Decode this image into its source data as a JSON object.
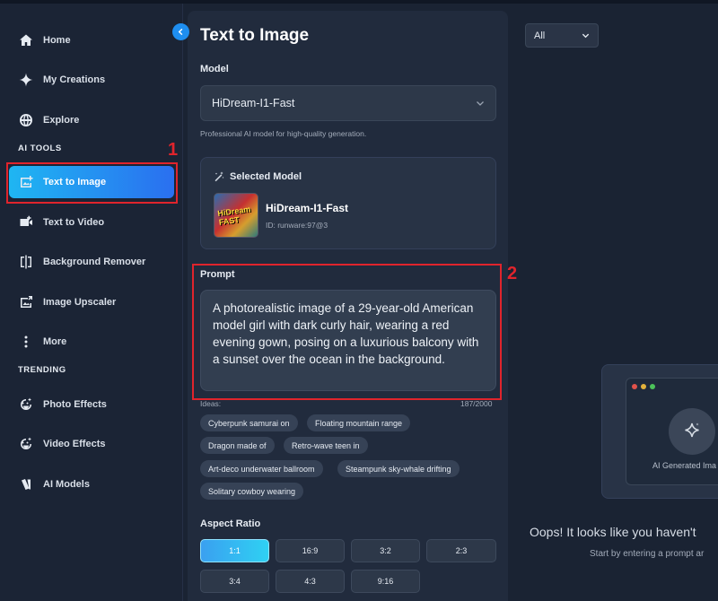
{
  "sidebar": {
    "items": [
      {
        "label": "Home",
        "icon": "home-icon"
      },
      {
        "label": "My Creations",
        "icon": "sparkle-icon"
      },
      {
        "label": "Explore",
        "icon": "globe-icon"
      },
      {
        "label": "Text to Image",
        "icon": "image-plus-icon",
        "active": true
      },
      {
        "label": "Text to Video",
        "icon": "video-plus-icon"
      },
      {
        "label": "Background Remover",
        "icon": "bg-remove-icon"
      },
      {
        "label": "Image Upscaler",
        "icon": "image-upscale-icon"
      },
      {
        "label": "More",
        "icon": "more-vertical-icon"
      },
      {
        "label": "Photo Effects",
        "icon": "effects-icon"
      },
      {
        "label": "Video Effects",
        "icon": "effects-icon"
      },
      {
        "label": "AI Models",
        "icon": "models-icon"
      }
    ],
    "section_ai_tools": "AI TOOLS",
    "section_trending": "TRENDING"
  },
  "annotations": {
    "callout_1": "1",
    "callout_2": "2"
  },
  "panel": {
    "title": "Text to Image",
    "model_label": "Model",
    "model_value": "HiDream-I1-Fast",
    "model_help": "Professional AI model for high-quality generation.",
    "selected_model_header": "Selected Model",
    "selected_model_name": "HiDream-I1-Fast",
    "selected_model_id": "ID: runware:97@3",
    "thumb_text": "HiDream FAST",
    "prompt_label": "Prompt",
    "prompt_text": "A photorealistic image of a 29-year-old American model girl with dark curly hair, wearing a red evening gown, posing on a luxurious balcony with a sunset over the ocean in the background.",
    "ideas_label": "Ideas:",
    "char_counter": "187/2000",
    "ideas": [
      "Cyberpunk samurai on",
      "Floating mountain range",
      "Dragon made of",
      "Retro-wave teen in",
      "Art-deco underwater ballroom",
      "Steampunk sky-whale drifting",
      "Solitary cowboy wearing"
    ],
    "aspect_ratio_label": "Aspect Ratio",
    "aspect_ratios": [
      "1:1",
      "16:9",
      "3:2",
      "2:3",
      "3:4",
      "4:3",
      "9:16"
    ],
    "aspect_ratio_selected": "1:1"
  },
  "right": {
    "filter_value": "All",
    "placeholder_caption": "AI Generated Ima",
    "empty_title": "Oops! It looks like you haven't",
    "empty_subtitle": "Start by entering a prompt ar"
  },
  "colors": {
    "accent_gradient_start": "#1fb6f2",
    "accent_gradient_end": "#2a6ff0",
    "annotation_red": "#e0242c",
    "background": "#1a2333"
  }
}
